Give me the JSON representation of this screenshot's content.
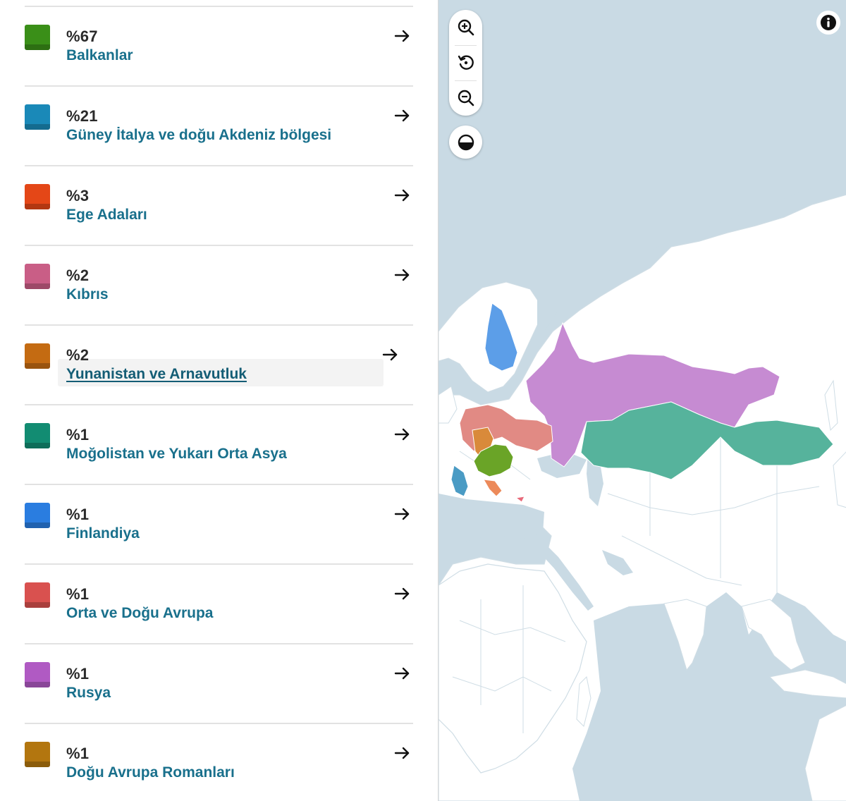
{
  "regions": [
    {
      "percent": "%67",
      "name": "Balkanlar",
      "color": "#3a8f18",
      "icon": "arrow-right-icon"
    },
    {
      "percent": "%21",
      "name": "Güney İtalya ve doğu Akdeniz bölgesi",
      "color": "#1a89b8",
      "icon": "arrow-right-icon"
    },
    {
      "percent": "%3",
      "name": "Ege Adaları",
      "color": "#e44717",
      "icon": "arrow-right-icon"
    },
    {
      "percent": "%2",
      "name": "Kıbrıs",
      "color": "#c95e86",
      "icon": "arrow-right-icon"
    },
    {
      "percent": "%2",
      "name": "Yunanistan ve Arnavutluk",
      "color": "#c46b12",
      "icon": "arrow-right-icon",
      "hovered": true
    },
    {
      "percent": "%1",
      "name": "Moğolistan ve Yukarı Orta Asya",
      "color": "#128c72",
      "icon": "arrow-right-icon"
    },
    {
      "percent": "%1",
      "name": "Finlandiya",
      "color": "#2a7de0",
      "icon": "arrow-right-icon"
    },
    {
      "percent": "%1",
      "name": "Orta ve Doğu Avrupa",
      "color": "#d9514f",
      "icon": "arrow-right-icon"
    },
    {
      "percent": "%1",
      "name": "Rusya",
      "color": "#b05ac3",
      "icon": "arrow-right-icon"
    },
    {
      "percent": "%1",
      "name": "Doğu Avrupa Romanları",
      "color": "#b3760f",
      "icon": "arrow-right-icon"
    }
  ],
  "map": {
    "controls": {
      "zoom_in": "zoom-in-icon",
      "reset": "reset-view-icon",
      "zoom_out": "zoom-out-icon",
      "contrast": "contrast-icon",
      "info": "info-icon"
    },
    "colors": {
      "water": "#c9dae4",
      "land": "#ffffff",
      "border": "#cfdde5"
    }
  }
}
